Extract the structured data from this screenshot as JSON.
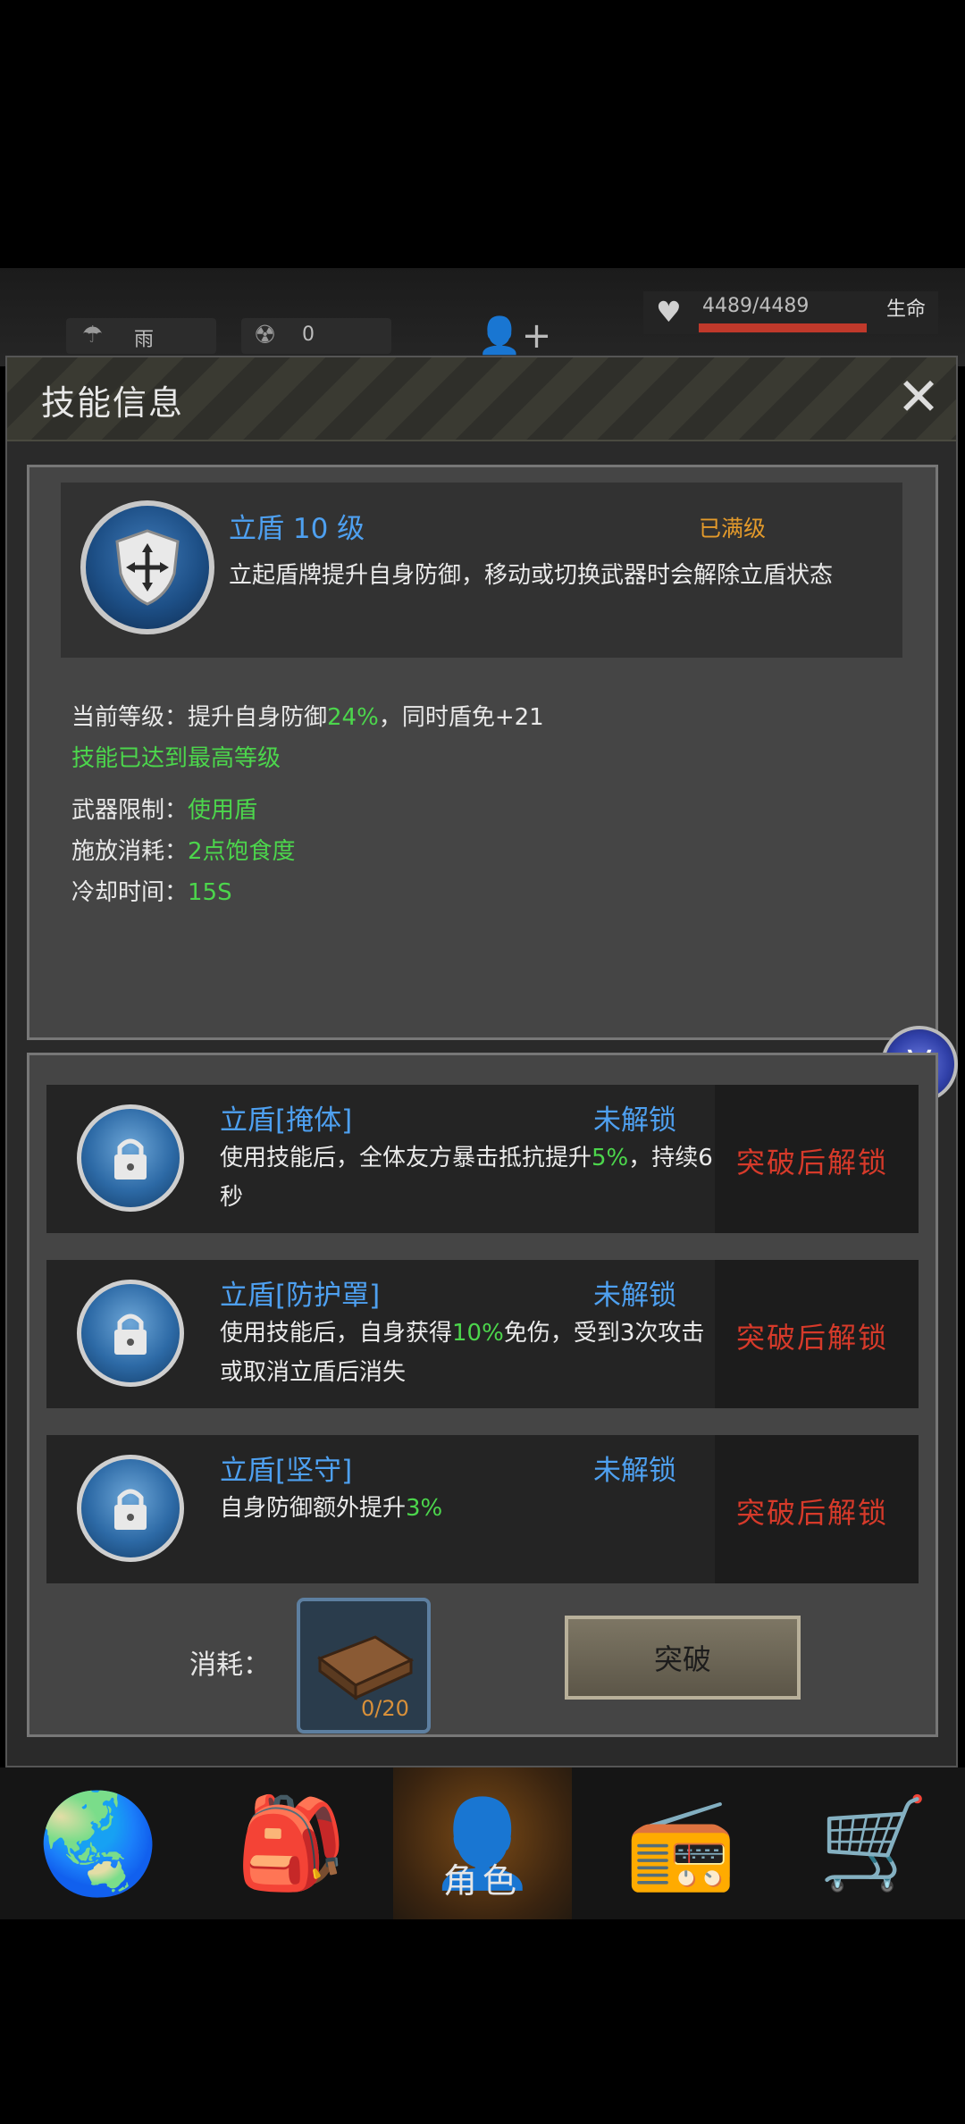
{
  "status_bar": {
    "weather": "雨",
    "radiation": "0",
    "hp": "4489/4489",
    "hp_fraction": 1.0,
    "hp_label": "生命"
  },
  "dialog": {
    "title": "技能信息"
  },
  "skill": {
    "name": "立盾 10 级",
    "status": "已满级",
    "description": "立起盾牌提升自身防御，移动或切换武器时会解除立盾状态",
    "current_level_prefix": "当前等级：提升自身防御",
    "current_level_value": "24%",
    "current_level_suffix": "，同时盾免+21",
    "max_level_note": "技能已达到最高等级",
    "weapon_label": "武器限制：",
    "weapon_value": "使用盾",
    "cost_label": "施放消耗：",
    "cost_value": "2点饱食度",
    "cooldown_label": "冷却时间：",
    "cooldown_value": "15S"
  },
  "talents": [
    {
      "name": "立盾[掩体]",
      "state": "未解锁",
      "desc_a": "使用技能后，全体友方暴击抵抗提升",
      "desc_highlight": "5%",
      "desc_b": "，持续6秒",
      "lock_text": "突破后解锁"
    },
    {
      "name": "立盾[防护罩]",
      "state": "未解锁",
      "desc_a": "使用技能后，自身获得",
      "desc_highlight": "10%",
      "desc_b": "免伤，受到3次攻击或取消立盾后消失",
      "lock_text": "突破后解锁"
    },
    {
      "name": "立盾[坚守]",
      "state": "未解锁",
      "desc_a": "自身防御额外提升",
      "desc_highlight": "3%",
      "desc_b": "",
      "lock_text": "突破后解锁"
    }
  ],
  "cost": {
    "label": "消耗：",
    "count": "0/20"
  },
  "break_button": "突破",
  "nav": {
    "active_label": "角色"
  },
  "colors": {
    "skill_blue": "#4ea0f0",
    "highlight_green": "#4cd64c",
    "lock_red": "#d63a2a",
    "max_orange": "#e39a2b"
  }
}
